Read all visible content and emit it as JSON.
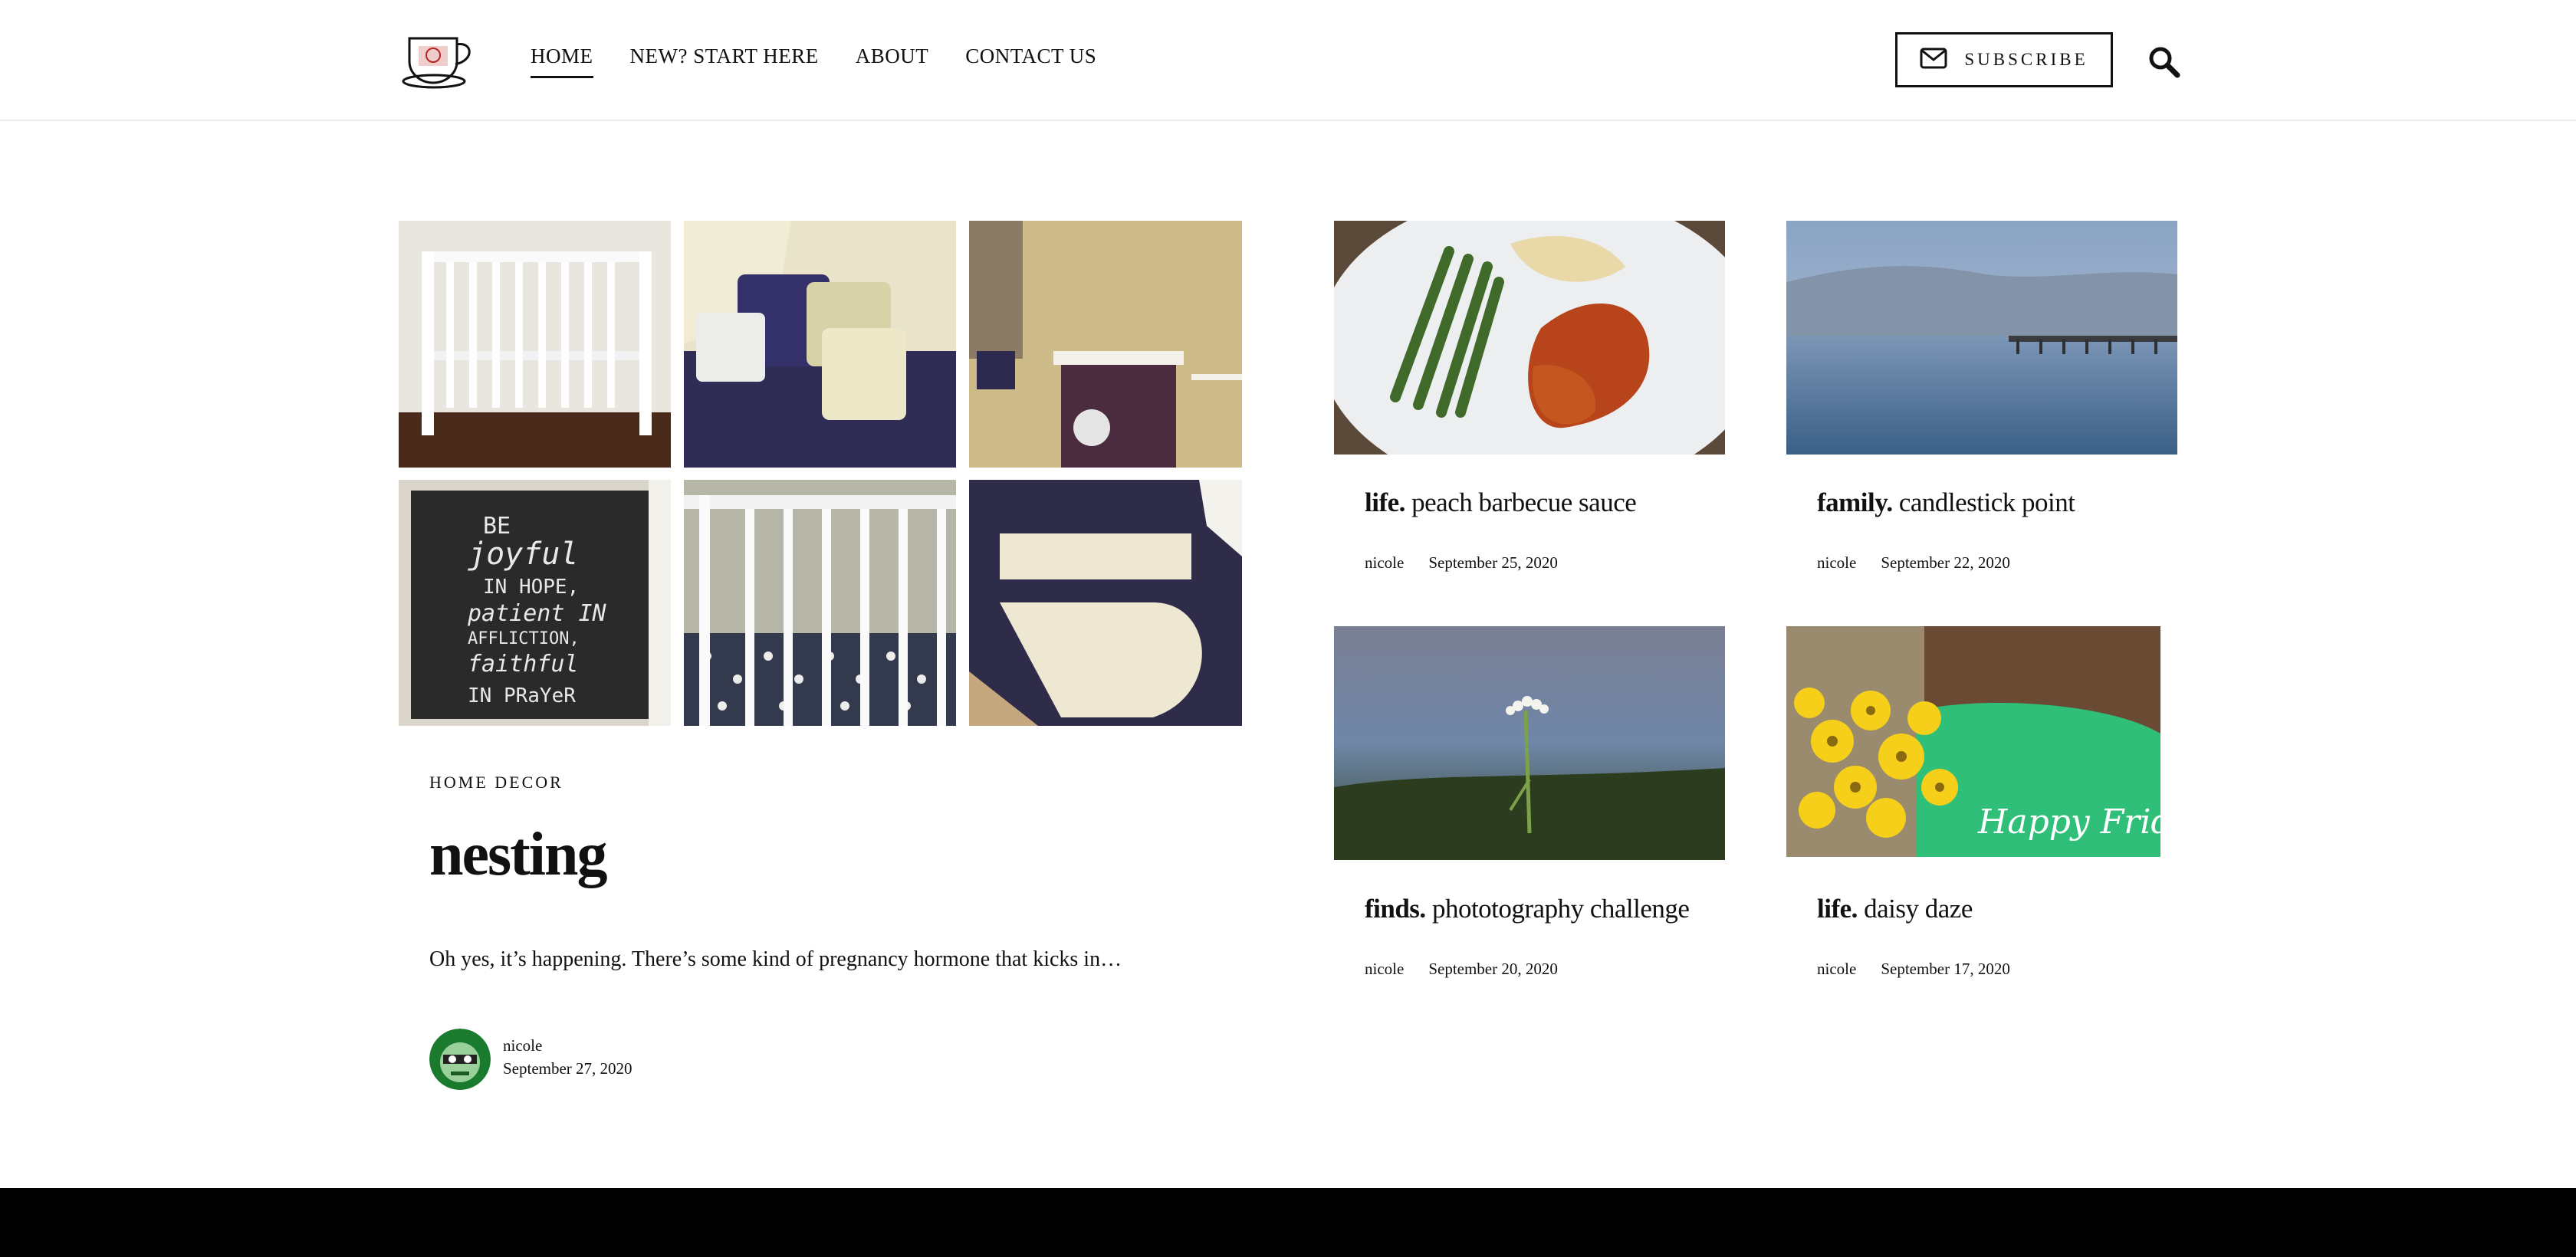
{
  "nav": {
    "items": [
      {
        "label": "HOME"
      },
      {
        "label": "NEW? START HERE"
      },
      {
        "label": "ABOUT"
      },
      {
        "label": "CONTACT US"
      }
    ],
    "subscribe_label": "SUBSCRIBE"
  },
  "featured": {
    "category": "HOME DECOR",
    "title": "nesting",
    "excerpt": "Oh yes, it’s happening. There’s some kind of pregnancy hormone that kicks in…",
    "author": "nicole",
    "date": "September 27, 2020",
    "poster_text": [
      "BE",
      "joyful",
      "IN HOPE,",
      "patient IN",
      "AFFLICTION,",
      "faithful",
      "IN PRaYeR"
    ]
  },
  "posts": [
    {
      "category": "life.",
      "title": "peach barbecue sauce",
      "author": "nicole",
      "date": "September 25, 2020"
    },
    {
      "category": "family.",
      "title": "candlestick point",
      "author": "nicole",
      "date": "September 22, 2020"
    },
    {
      "category": "finds.",
      "title": "phototography challenge",
      "author": "nicole",
      "date": "September 20, 2020"
    },
    {
      "category": "life.",
      "title": "daisy daze",
      "author": "nicole",
      "date": "September 17, 2020",
      "image_text": "Happy Friday!"
    }
  ],
  "icons": {
    "logo": "teacup-logo-icon",
    "mail": "mail-icon",
    "search": "search-icon"
  }
}
